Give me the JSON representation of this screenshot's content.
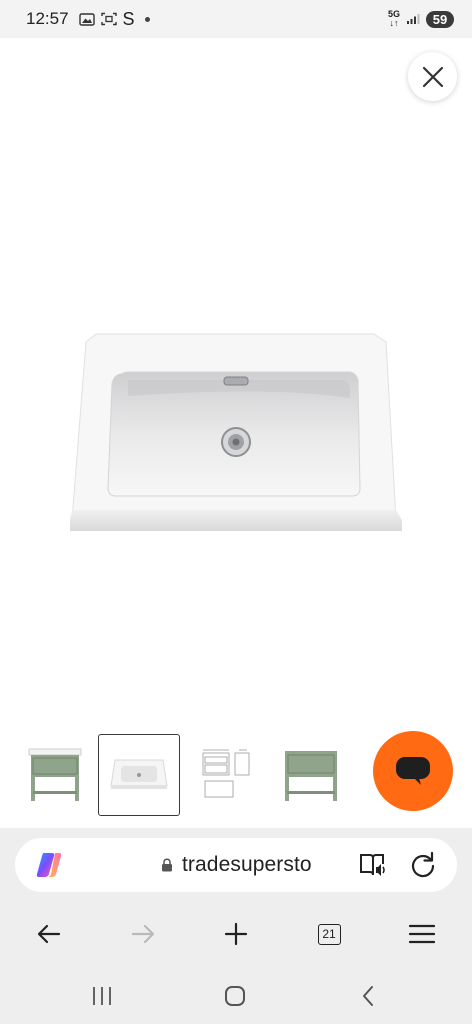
{
  "status_bar": {
    "time": "12:57",
    "s_indicator": "S",
    "network": "5G",
    "battery": "59"
  },
  "icons": {
    "close": "close-icon",
    "chat": "chat-bubble-icon",
    "copilot": "copilot-icon",
    "lock": "lock-icon",
    "reader": "read-aloud-icon",
    "reload": "reload-icon",
    "back": "back-arrow-icon",
    "forward": "forward-arrow-icon",
    "new_tab": "plus-icon",
    "menu": "hamburger-menu-icon"
  },
  "gallery": {
    "main_image": "white ceramic basin",
    "thumbnails": [
      "green vanity unit with basin",
      "white ceramic basin",
      "technical drawing",
      "green vanity unit without basin"
    ],
    "selected_index": 1
  },
  "browser": {
    "url": "tradesupersto",
    "tab_count": "21"
  },
  "colors": {
    "accent_orange": "#ff6a13",
    "vanity_green": "#8fa48b",
    "browser_bg": "#eeeeee"
  }
}
